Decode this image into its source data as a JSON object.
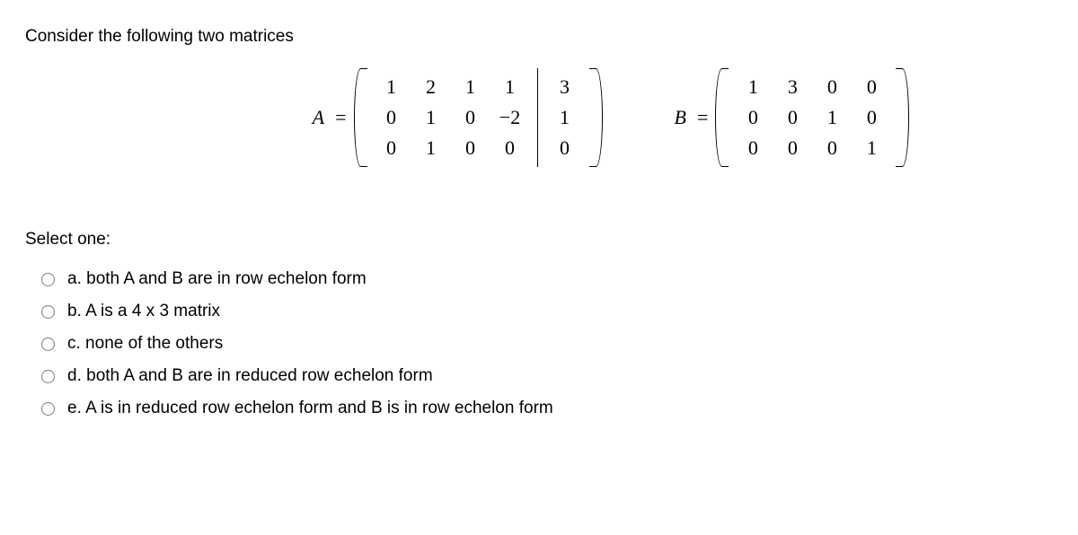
{
  "question_text": "Consider the following two matrices",
  "matrixA": {
    "label": "A",
    "eq": "=",
    "main": [
      [
        "1",
        "2",
        "1",
        "1"
      ],
      [
        "0",
        "1",
        "0",
        "−2"
      ],
      [
        "0",
        "1",
        "0",
        "0"
      ]
    ],
    "aug": [
      "3",
      "1",
      "0"
    ]
  },
  "matrixB": {
    "label": "B",
    "eq": "=",
    "main": [
      [
        "1",
        "3",
        "0",
        "0"
      ],
      [
        "0",
        "0",
        "1",
        "0"
      ],
      [
        "0",
        "0",
        "0",
        "1"
      ]
    ]
  },
  "select_label": "Select one:",
  "options": {
    "a": "a. both A and B are in row echelon form",
    "b": "b. A is a 4  x 3 matrix",
    "c": "c. none of the others",
    "d": "d. both A and B are in reduced row echelon form",
    "e": "e. A is in reduced row echelon form and B is in row echelon form"
  }
}
